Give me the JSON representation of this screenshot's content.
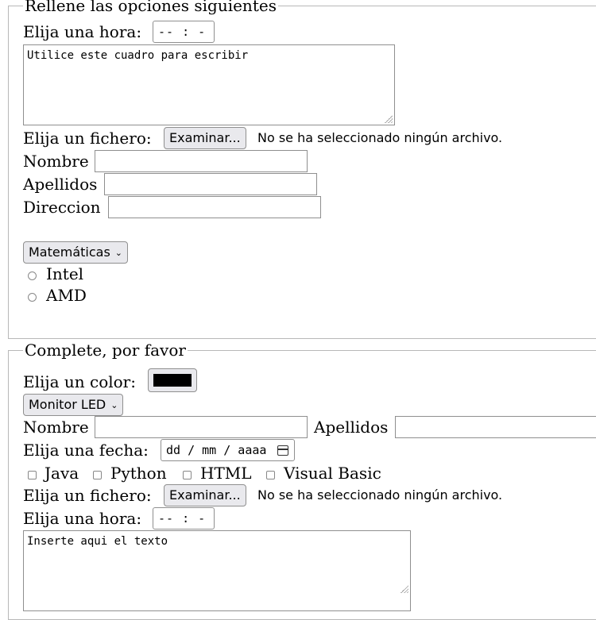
{
  "fieldset1": {
    "legend": "Rellene las opciones siguientes",
    "time_label": "Elija una hora:",
    "time_value": "-- : --",
    "textarea_value": "Utilice este cuadro para escribir",
    "file_label": "Elija un fichero:",
    "file_button": "Examinar...",
    "file_status": "No se ha seleccionado ningún archivo.",
    "nombre_label": "Nombre",
    "apellidos_label": "Apellidos",
    "direccion_label": "Direccion",
    "select_value": "Matemáticas",
    "radios": [
      "Intel",
      "AMD"
    ]
  },
  "fieldset2": {
    "legend": "Complete, por favor",
    "color_label": "Elija un color:",
    "color_value": "#000000",
    "select_value": "Monitor LED",
    "nombre_label": "Nombre",
    "apellidos_label": "Apellidos",
    "date_label": "Elija una fecha:",
    "date_placeholder": "dd / mm / aaaa",
    "checkboxes": [
      "Java",
      "Python",
      "HTML",
      "Visual Basic"
    ],
    "file_label": "Elija un fichero:",
    "file_button": "Examinar...",
    "file_status": "No se ha seleccionado ningún archivo.",
    "time_label": "Elija una hora:",
    "time_value": "-- : --",
    "textarea_value": "Inserte aqui el texto"
  }
}
